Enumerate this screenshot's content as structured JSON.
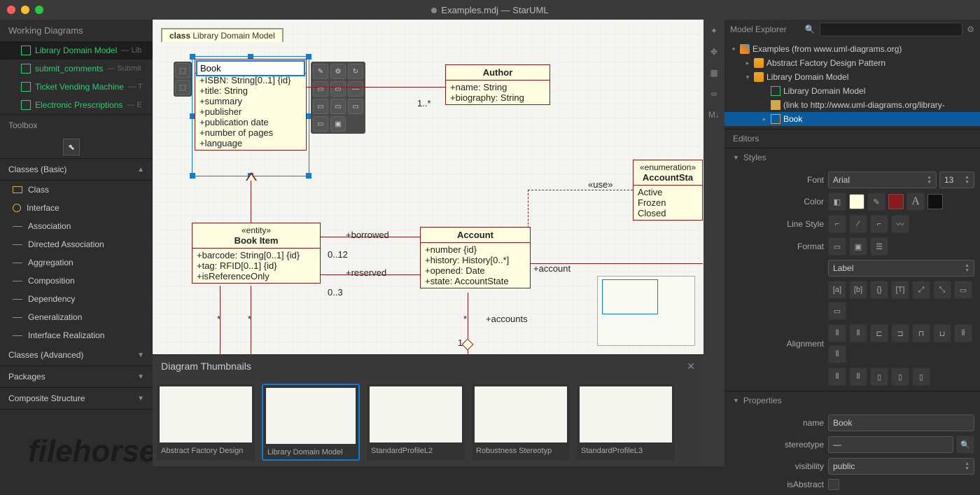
{
  "title": {
    "file": "Examples.mdj",
    "app": "StarUML"
  },
  "left": {
    "workingHdr": "Working Diagrams",
    "diagrams": [
      {
        "name": "Library Domain Model",
        "sub": "— Lib"
      },
      {
        "name": "submit_comments",
        "sub": "— Submit"
      },
      {
        "name": "Ticket Vending Machine",
        "sub": "— T"
      },
      {
        "name": "Electronic Prescriptions",
        "sub": "— E"
      }
    ],
    "toolboxHdr": "Toolbox",
    "sections": {
      "basic": "Classes (Basic)",
      "advanced": "Classes (Advanced)",
      "packages": "Packages",
      "composite": "Composite Structure"
    },
    "basicItems": [
      "Class",
      "Interface",
      "Association",
      "Directed Association",
      "Aggregation",
      "Composition",
      "Dependency",
      "Generalization",
      "Interface Realization"
    ]
  },
  "canvas": {
    "tabPrefix": "class",
    "tabTitle": "Library Domain Model",
    "bookEdit": "Book",
    "bookAttrs": [
      "+ISBN: String[0..1] {id}",
      "+title: String",
      "+summary",
      "+publisher",
      "+publication date",
      "+number of pages",
      "+language"
    ],
    "author": {
      "name": "Author",
      "attrs": [
        "+name: String",
        "+biography: String"
      ]
    },
    "assocMult": "1..*",
    "enum": {
      "stereo": "«enumeration»",
      "name": "AccountSta",
      "vals": [
        "Active",
        "Frozen",
        "Closed"
      ]
    },
    "useLbl": "«use»",
    "bookItem": {
      "stereo": "«entity»",
      "name": "Book Item",
      "attrs": [
        "+barcode: String[0..1] {id}",
        "+tag: RFID[0..1] {id}",
        "+isReferenceOnly"
      ]
    },
    "account": {
      "name": "Account",
      "attrs": [
        "+number {id}",
        "+history: History[0..*]",
        "+opened: Date",
        "+state: AccountState"
      ]
    },
    "labels": {
      "borrowed": "+borrowed",
      "borrowedM": "0..12",
      "reserved": "+reserved",
      "reservedM": "0..3",
      "star1": "*",
      "star2": "*",
      "acct": "+account",
      "accts": "+accounts",
      "acctsStar": "*",
      "one": "1"
    }
  },
  "thumbs": {
    "hdr": "Diagram Thumbnails",
    "items": [
      "Abstract Factory Design",
      "Library Domain Model",
      "StandardProfileL2",
      "Robustness Stereotyp",
      "StandardProfileL3"
    ]
  },
  "tree": {
    "hdr": "Model Explorer",
    "root": "Examples (from www.uml-diagrams.org)",
    "nodes": {
      "abstract": "Abstract Factory Design Pattern",
      "lib": "Library Domain Model",
      "libDiag": "Library Domain Model",
      "link": "(link to http://www.uml-diagrams.org/library-",
      "book": "Book"
    }
  },
  "editors": {
    "hdr": "Editors",
    "styles": "Styles",
    "fontLbl": "Font",
    "font": "Arial",
    "size": "13",
    "colorLbl": "Color",
    "lineLbl": "Line Style",
    "formatLbl": "Format",
    "formatSel": "Label",
    "alignLbl": "Alignment",
    "props": "Properties",
    "nameLbl": "name",
    "nameVal": "Book",
    "stereoLbl": "stereotype",
    "stereoVal": "—",
    "visLbl": "visibility",
    "visVal": "public",
    "absLbl": "isAbstract"
  },
  "watermark": "filehorse.com"
}
